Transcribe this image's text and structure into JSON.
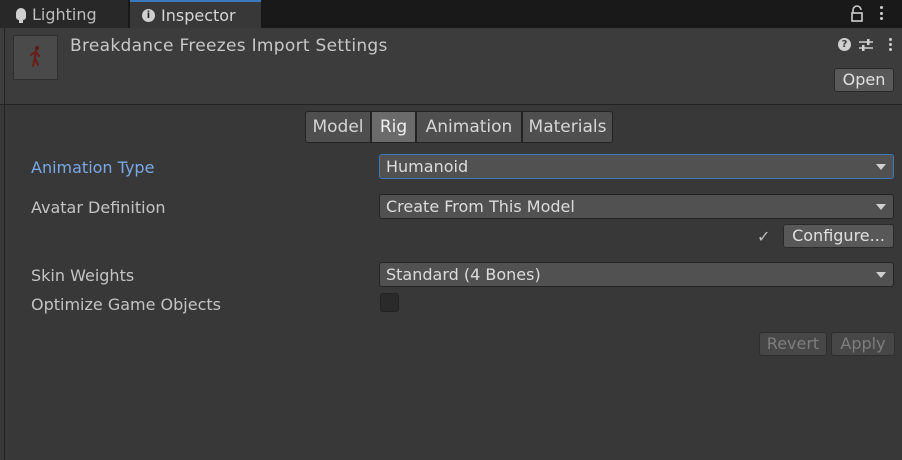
{
  "tabs": {
    "lighting_label": "Lighting",
    "inspector_label": "Inspector"
  },
  "header": {
    "title": "Breakdance Freezes Import Settings",
    "open_label": "Open",
    "help_icon": "?"
  },
  "segments": {
    "model": "Model",
    "rig": "Rig",
    "animation": "Animation",
    "materials": "Materials",
    "selected": "Rig"
  },
  "fields": {
    "animation_type_label": "Animation Type",
    "animation_type_value": "Humanoid",
    "avatar_definition_label": "Avatar Definition",
    "avatar_definition_value": "Create From This Model",
    "configure_label": "Configure...",
    "check_glyph": "✓",
    "skin_weights_label": "Skin Weights",
    "skin_weights_value": "Standard (4 Bones)",
    "optimize_label": "Optimize Game Objects",
    "optimize_checked": false
  },
  "footer": {
    "revert_label": "Revert",
    "apply_label": "Apply"
  },
  "colors": {
    "accent": "#3a79bb",
    "active_label": "#7ba8e6",
    "background": "#383838"
  }
}
